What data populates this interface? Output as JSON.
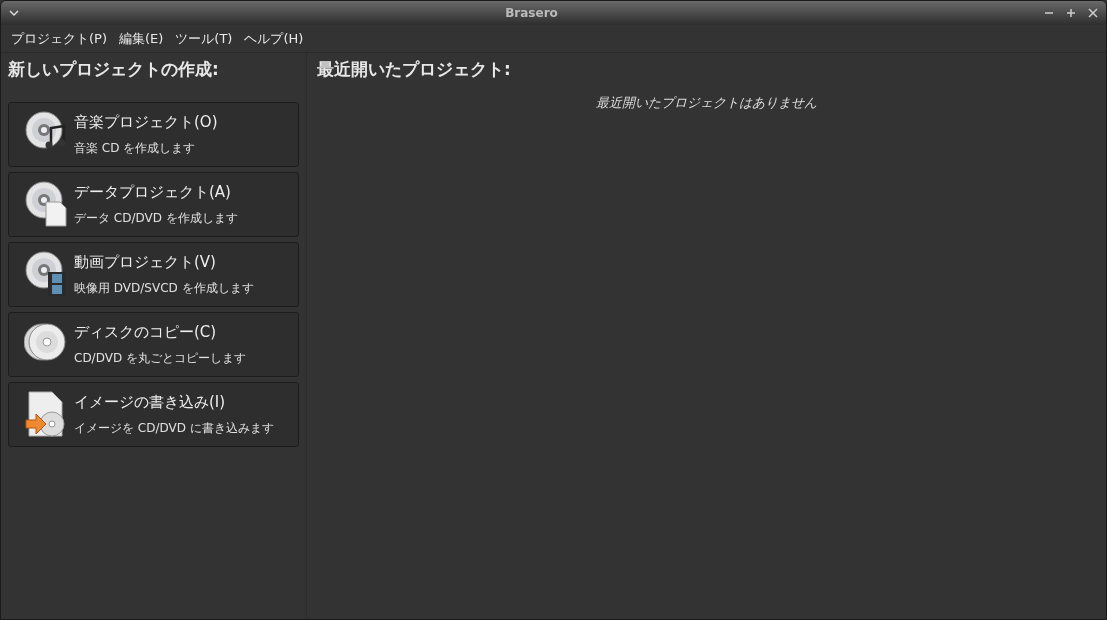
{
  "window": {
    "title": "Brasero"
  },
  "menu": [
    "プロジェクト(P)",
    "編集(E)",
    "ツール(T)",
    "ヘルプ(H)"
  ],
  "new_project": {
    "heading": "新しいプロジェクトの作成:",
    "items": [
      {
        "kind": "music",
        "title": "音楽プロジェクト(O)",
        "description": "音楽 CD を作成します"
      },
      {
        "kind": "data",
        "title": "データプロジェクト(A)",
        "description": "データ CD/DVD を作成します"
      },
      {
        "kind": "video",
        "title": "動画プロジェクト(V)",
        "description": "映像用 DVD/SVCD を作成します"
      },
      {
        "kind": "copy",
        "title": "ディスクのコピー(C)",
        "description": "CD/DVD を丸ごとコピーします"
      },
      {
        "kind": "image",
        "title": "イメージの書き込み(I)",
        "description": "イメージを CD/DVD に書き込みます"
      }
    ]
  },
  "recent": {
    "heading": "最近開いたプロジェクト:",
    "empty_message": "最近開いたプロジェクトはありません"
  }
}
